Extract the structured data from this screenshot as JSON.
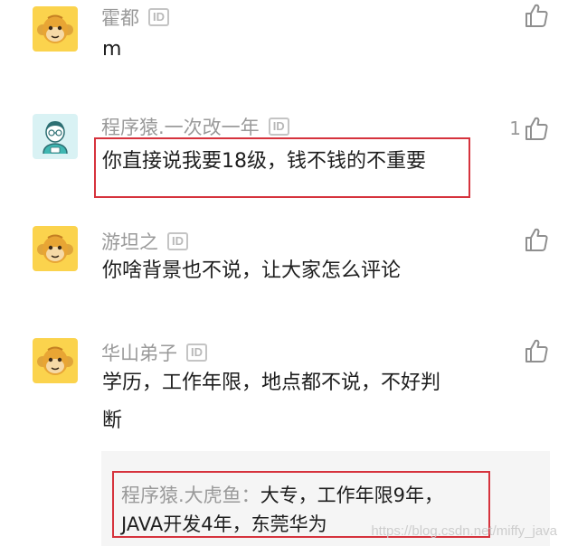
{
  "comments": [
    {
      "username": "霍都",
      "id_badge": "ID",
      "text": "m",
      "likes": "",
      "avatar_icon": "monkey-avatar-icon"
    },
    {
      "username": "程序猿.一次改一年",
      "id_badge": "ID",
      "text": "你直接说我要18级，钱不钱的不重要",
      "likes": "1",
      "avatar_icon": "coder-avatar-icon"
    },
    {
      "username": "游坦之",
      "id_badge": "ID",
      "text": "你啥背景也不说，让大家怎么评论",
      "likes": "",
      "avatar_icon": "monkey-avatar-icon"
    },
    {
      "username": "华山弟子",
      "id_badge": "ID",
      "text_line1": "学历，工作年限，地点都不说，不好判",
      "text_line2": "断",
      "likes": "",
      "avatar_icon": "monkey-avatar-icon"
    }
  ],
  "reply": {
    "author": "程序猿.大虎鱼：",
    "text_line1": "大专，工作年限9年，",
    "text_line2": "JAVA开发4年，东莞华为"
  },
  "watermark": "https://blog.csdn.net/miffy_java",
  "colors": {
    "highlight_border": "#d6333d",
    "username": "#9a9a9a",
    "avatar_bg": "#fbd34d",
    "reply_bg": "#f5f5f5"
  },
  "icons": {
    "like": "thumbs-up-icon"
  }
}
